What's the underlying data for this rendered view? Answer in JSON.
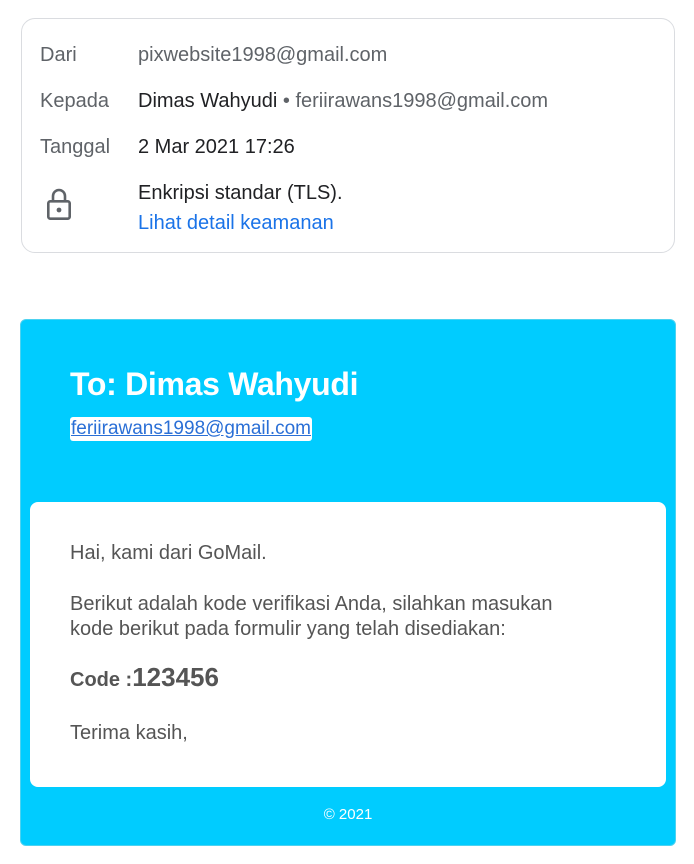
{
  "details": {
    "from_label": "Dari",
    "from_value": "pixwebsite1998@gmail.com",
    "to_label": "Kepada",
    "to_name": "Dimas Wahyudi",
    "to_separator": "•",
    "to_email": "feriirawans1998@gmail.com",
    "date_label": "Tanggal",
    "date_value": "2 Mar 2021 17:26",
    "security_text": "Enkripsi standar (TLS).",
    "security_link": "Lihat detail keamanan",
    "security_icon": "lock-icon"
  },
  "email": {
    "heading": "To: Dimas Wahyudi",
    "recipient_link": "feriirawans1998@gmail.com",
    "greeting": "Hai, kami dari GoMail.",
    "instruction_line1": "Berikut adalah kode verifikasi Anda, silahkan masukan",
    "instruction_line2": "kode berikut pada formulir yang telah disediakan:",
    "code_label": "Code :",
    "code_value": "123456",
    "closing": "Terima kasih,",
    "footer": "© 2021",
    "colors": {
      "panel_bg": "#00ccff",
      "link": "#1a73e8"
    }
  }
}
